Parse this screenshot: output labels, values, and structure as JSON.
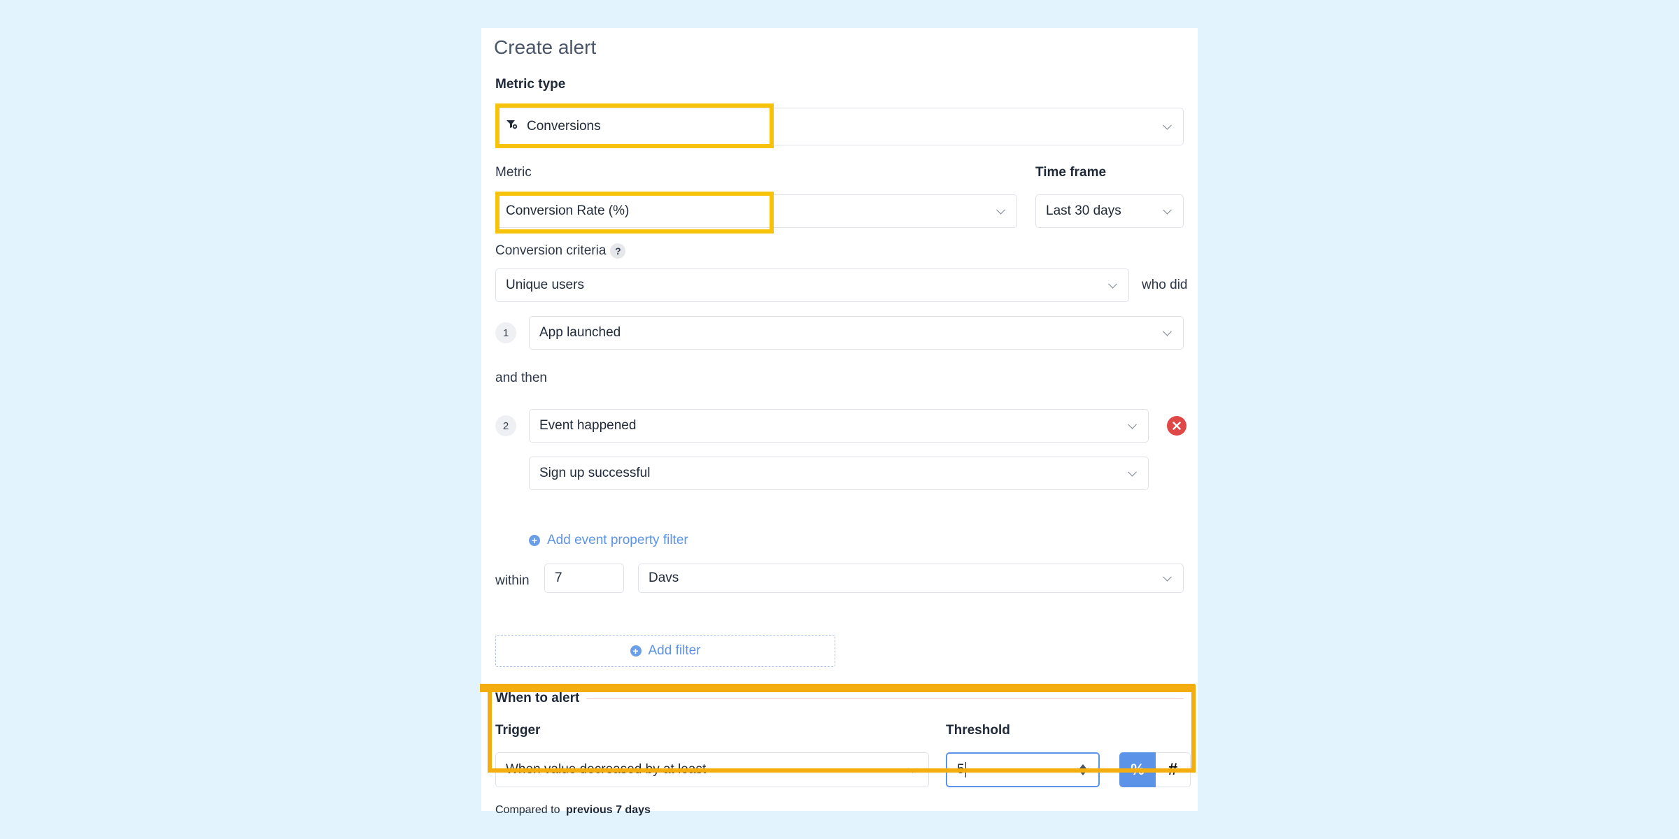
{
  "form": {
    "title": "Create alert",
    "metric_type": {
      "label": "Metric type",
      "value": "Conversions",
      "icon": "conversions-icon"
    },
    "metric": {
      "label": "Metric",
      "value": "Conversion Rate (%)"
    },
    "time_frame": {
      "label": "Time frame",
      "value": "Last 30 days"
    },
    "conversion_criteria": {
      "label": "Conversion criteria",
      "help": "?",
      "users_value": "Unique users",
      "who_did": "who did"
    },
    "steps": [
      {
        "number": "1",
        "event": "App launched"
      },
      {
        "number": "2",
        "event": "Event happened",
        "sub_event": "Sign up successful"
      }
    ],
    "and_then": "and then",
    "add_event_property_filter": "Add event property filter",
    "within": {
      "label": "within",
      "amount": "7",
      "unit": "Davs"
    },
    "add_filter": "Add filter",
    "when_to_alert": {
      "label": "When to alert",
      "trigger_label": "Trigger",
      "trigger_value": "When value decreased by at least",
      "threshold_label": "Threshold",
      "threshold_value": "5",
      "unit_percent": "%",
      "unit_number": "#",
      "compared_to_label": "Compared to",
      "compared_to_value": "previous 7 days"
    }
  },
  "colors": {
    "background": "#e3f3fd",
    "highlight_yellow": "#f7c20a",
    "highlight_orange": "#f3ad0e",
    "accent_blue": "#5b93e8",
    "danger_red": "#e04848"
  }
}
